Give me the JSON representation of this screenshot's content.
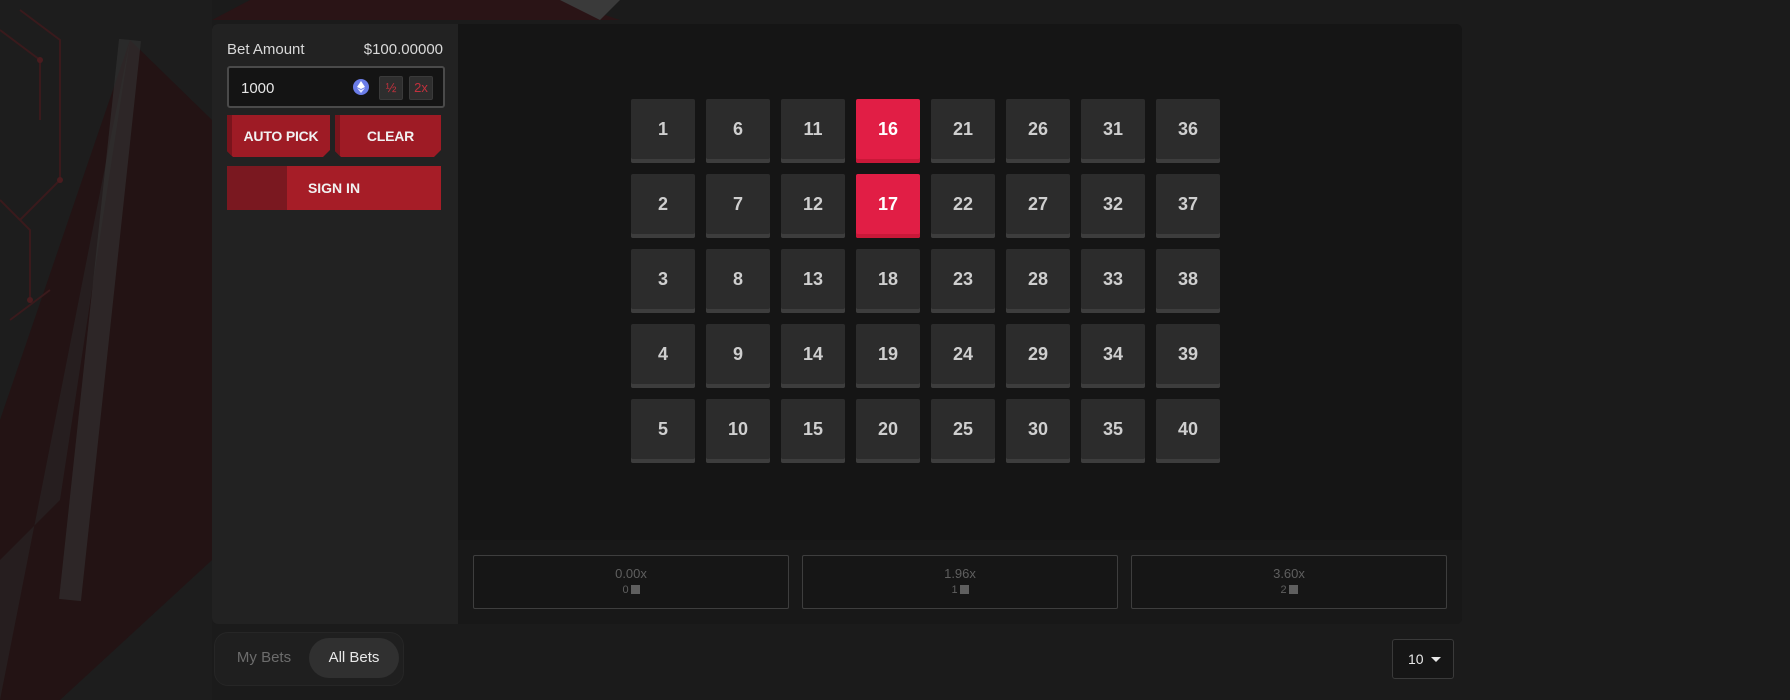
{
  "sidebar": {
    "bet_amount_label": "Bet Amount",
    "balance": "$100.00000",
    "bet_input_value": "1000",
    "half_label": "½",
    "double_label": "2x",
    "auto_pick_label": "AUTO PICK",
    "clear_label": "CLEAR",
    "sign_in_label": "SIGN IN"
  },
  "board": {
    "columns": [
      [
        "1",
        "2",
        "3",
        "4",
        "5"
      ],
      [
        "6",
        "7",
        "8",
        "9",
        "10"
      ],
      [
        "11",
        "12",
        "13",
        "14",
        "15"
      ],
      [
        "16",
        "17",
        "18",
        "19",
        "20"
      ],
      [
        "21",
        "22",
        "23",
        "24",
        "25"
      ],
      [
        "26",
        "27",
        "28",
        "29",
        "30"
      ],
      [
        "31",
        "32",
        "33",
        "34",
        "35"
      ],
      [
        "36",
        "37",
        "38",
        "39",
        "40"
      ]
    ],
    "selected": [
      "16",
      "17"
    ]
  },
  "payouts": [
    {
      "multiplier": "0.00x",
      "hits": "0"
    },
    {
      "multiplier": "1.96x",
      "hits": "1"
    },
    {
      "multiplier": "3.60x",
      "hits": "2"
    }
  ],
  "bets_tabs": {
    "my_bets": "My Bets",
    "all_bets": "All Bets",
    "active": "All Bets"
  },
  "page_size": "10",
  "colors": {
    "accent_red": "#9e1b25",
    "selected_tile": "#e11e45",
    "coin_blue": "#6a7ce8"
  },
  "icons": {
    "coin": "eth-coin-icon",
    "dropdown": "chevron-down-icon",
    "gem": "square-gem-icon"
  }
}
